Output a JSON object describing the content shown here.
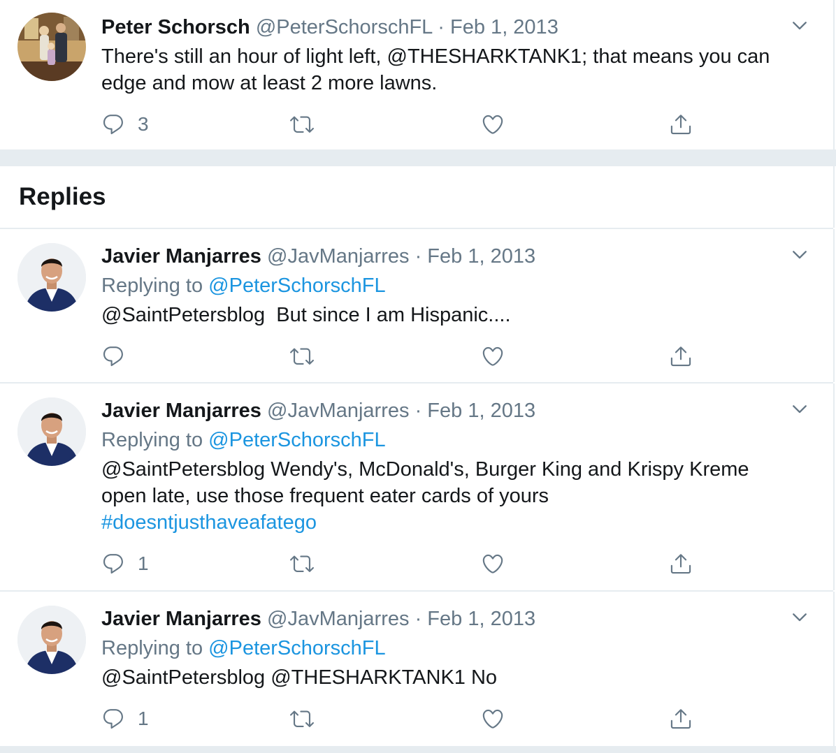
{
  "main_tweet": {
    "name": "Peter Schorsch",
    "handle": "@PeterSchorschFL",
    "dot": "·",
    "date": "Feb 1, 2013",
    "text_parts": [
      "There's still an hour of light left, @THESHARKTANK1; that means you can edge and mow at least 2 more lawns."
    ],
    "reply_count": "3"
  },
  "replies_heading": "Replies",
  "replies": [
    {
      "name": "Javier Manjarres",
      "handle": "@JavManjarres",
      "dot": "·",
      "date": "Feb 1, 2013",
      "replying_prefix": "Replying to ",
      "replying_to": "@PeterSchorschFL",
      "text": "@SaintPetersblog  But since I am Hispanic....",
      "reply_count": ""
    },
    {
      "name": "Javier Manjarres",
      "handle": "@JavManjarres",
      "dot": "·",
      "date": "Feb 1, 2013",
      "replying_prefix": "Replying to ",
      "replying_to": "@PeterSchorschFL",
      "text_line1": "@SaintPetersblog Wendy's, McDonald's, Burger King and Krispy Kreme",
      "text_line2": "open late, use those frequent eater cards of yours",
      "hashtag": "#doesntjusthaveafatego",
      "reply_count": "1"
    },
    {
      "name": "Javier Manjarres",
      "handle": "@JavManjarres",
      "dot": "·",
      "date": "Feb 1, 2013",
      "replying_prefix": "Replying to ",
      "replying_to": "@PeterSchorschFL",
      "text": "@SaintPetersblog @THESHARKTANK1 No",
      "reply_count": "1"
    }
  ],
  "colors": {
    "text": "#14171a",
    "muted": "#657786",
    "link": "#1b95e0",
    "divider": "#e6ecf0"
  },
  "icons": [
    "reply-icon",
    "retweet-icon",
    "like-icon",
    "share-icon",
    "chevron-down-icon"
  ]
}
